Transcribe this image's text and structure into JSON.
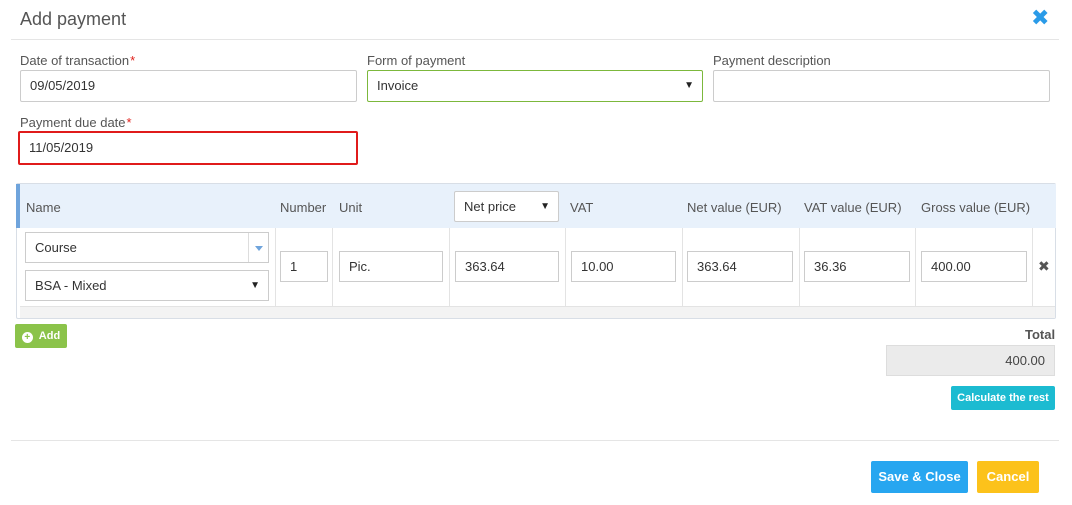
{
  "dialog": {
    "title": "Add payment",
    "close_icon": "close-icon"
  },
  "form": {
    "date_of_transaction": {
      "label": "Date of transaction",
      "required_mark": "*",
      "value": "09/05/2019"
    },
    "form_of_payment": {
      "label": "Form of payment",
      "value": "Invoice"
    },
    "payment_description": {
      "label": "Payment description",
      "value": ""
    },
    "payment_due_date": {
      "label": "Payment due date",
      "required_mark": "*",
      "value": "11/05/2019"
    }
  },
  "table": {
    "columns": {
      "name": "Name",
      "number": "Number",
      "unit": "Unit",
      "price_type": "Net price",
      "vat": "VAT",
      "net_value": "Net value (EUR)",
      "vat_value": "VAT value (EUR)",
      "gross_value": "Gross value (EUR)"
    },
    "rows": [
      {
        "name": "Course",
        "variant": "BSA - Mixed",
        "number": "1",
        "unit": "Pic.",
        "price": "363.64",
        "vat": "10.00",
        "net_value": "363.64",
        "vat_value": "36.36",
        "gross_value": "400.00"
      }
    ]
  },
  "actions": {
    "add_label": "Add",
    "total_label": "Total",
    "total_value": "400.00",
    "calculate_label": "Calculate the rest",
    "save_close_label": "Save & Close",
    "cancel_label": "Cancel"
  },
  "colors": {
    "accent_blue": "#27a6f0",
    "add_green": "#8bc34a",
    "calc_teal": "#1cbbd1",
    "cancel_yellow": "#fcc21b",
    "required_red": "#e0201b",
    "highlight_red": "#e01b1b"
  }
}
